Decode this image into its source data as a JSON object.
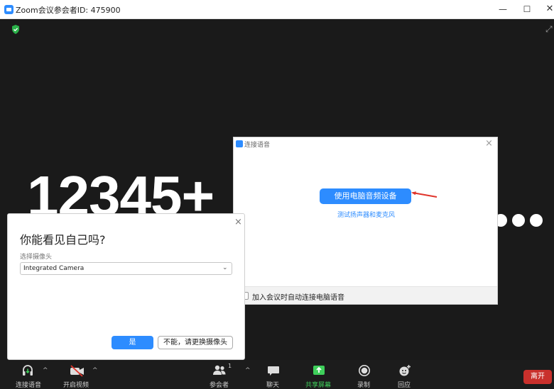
{
  "window": {
    "title": "Zoom会议参会者ID: 475900",
    "controls": {
      "minimize": "—",
      "maximize": "☐",
      "close": "✕"
    }
  },
  "stage": {
    "meeting_id_display": "12345+",
    "colors": {
      "background": "#1a1a1a",
      "shield": "#2bb14a"
    }
  },
  "audio_dialog": {
    "title": "连接语音",
    "close": "×",
    "primary_button": "使用电脑音频设备",
    "test_link": "测试扬声器和麦克风",
    "auto_connect_label": "加入会议时自动连接电脑语音",
    "auto_connect_checked": false
  },
  "camera_dialog": {
    "close": "×",
    "title": "你能看见自己吗?",
    "select_label": "选择摄像头",
    "selected_camera": "Integrated Camera",
    "chevron": "⌄",
    "yes_button": "是",
    "no_button": "不能，请更换摄像头"
  },
  "toolbar": {
    "audio_label": "连接语音",
    "video_label": "开启视频",
    "participants_label": "参会者",
    "participants_count": "1",
    "chat_label": "聊天",
    "share_label": "共享屏幕",
    "record_label": "录制",
    "reactions_label": "回应",
    "leave_label": "离开",
    "caret": "^",
    "colors": {
      "share": "#3ecf5a",
      "leave": "#c9302c",
      "accent": "#2D8CFF"
    }
  }
}
